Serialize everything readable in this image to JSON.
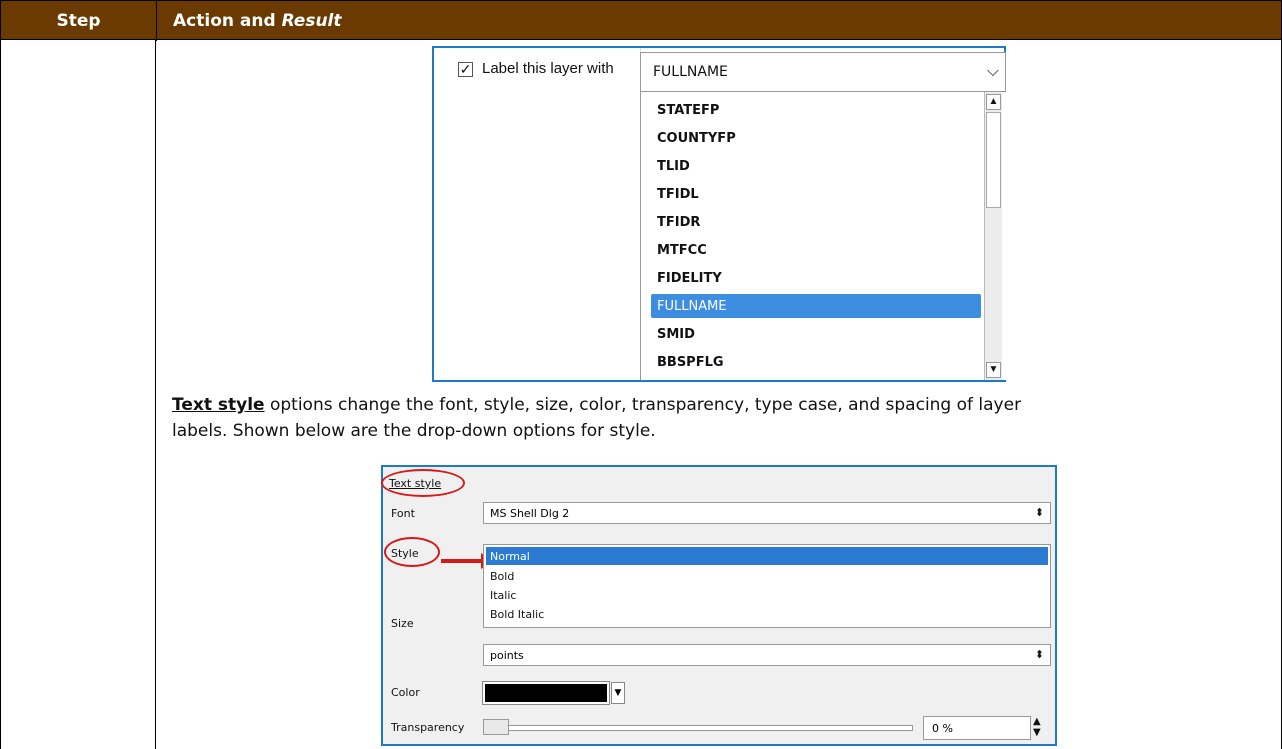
{
  "header": {
    "step": "Step",
    "action": "Action and",
    "result": "Result"
  },
  "layer_label": {
    "checkbox_label": "Label this layer with",
    "selected_field": "FULLNAME",
    "options": [
      "STATEFP",
      "COUNTYFP",
      "TLID",
      "TFIDL",
      "TFIDR",
      "MTFCC",
      "FIDELITY",
      "FULLNAME",
      "SMID",
      "BBSPFLG"
    ],
    "selected_index": 7
  },
  "paragraph": {
    "term": "Text style",
    "text_line1": " options change the font, style, size, color, transparency, type case, and spacing of layer",
    "text_line2": "labels. Shown below are the drop-down options for style."
  },
  "text_style_panel": {
    "title": "Text style",
    "font_label": "Font",
    "font_value": "MS Shell Dlg 2",
    "style_label": "Style",
    "style_options": [
      "Normal",
      "Bold",
      "Italic",
      "Bold Italic"
    ],
    "style_selected": "Normal",
    "size_label": "Size",
    "size_unit": "points",
    "color_label": "Color",
    "color_value": "#000000",
    "transparency_label": "Transparency",
    "transparency_value": "0 %"
  },
  "colors": {
    "header_bg": "#6b3a00",
    "accent_blue": "#1f7ac6",
    "annotation_red": "#d61a1a"
  }
}
